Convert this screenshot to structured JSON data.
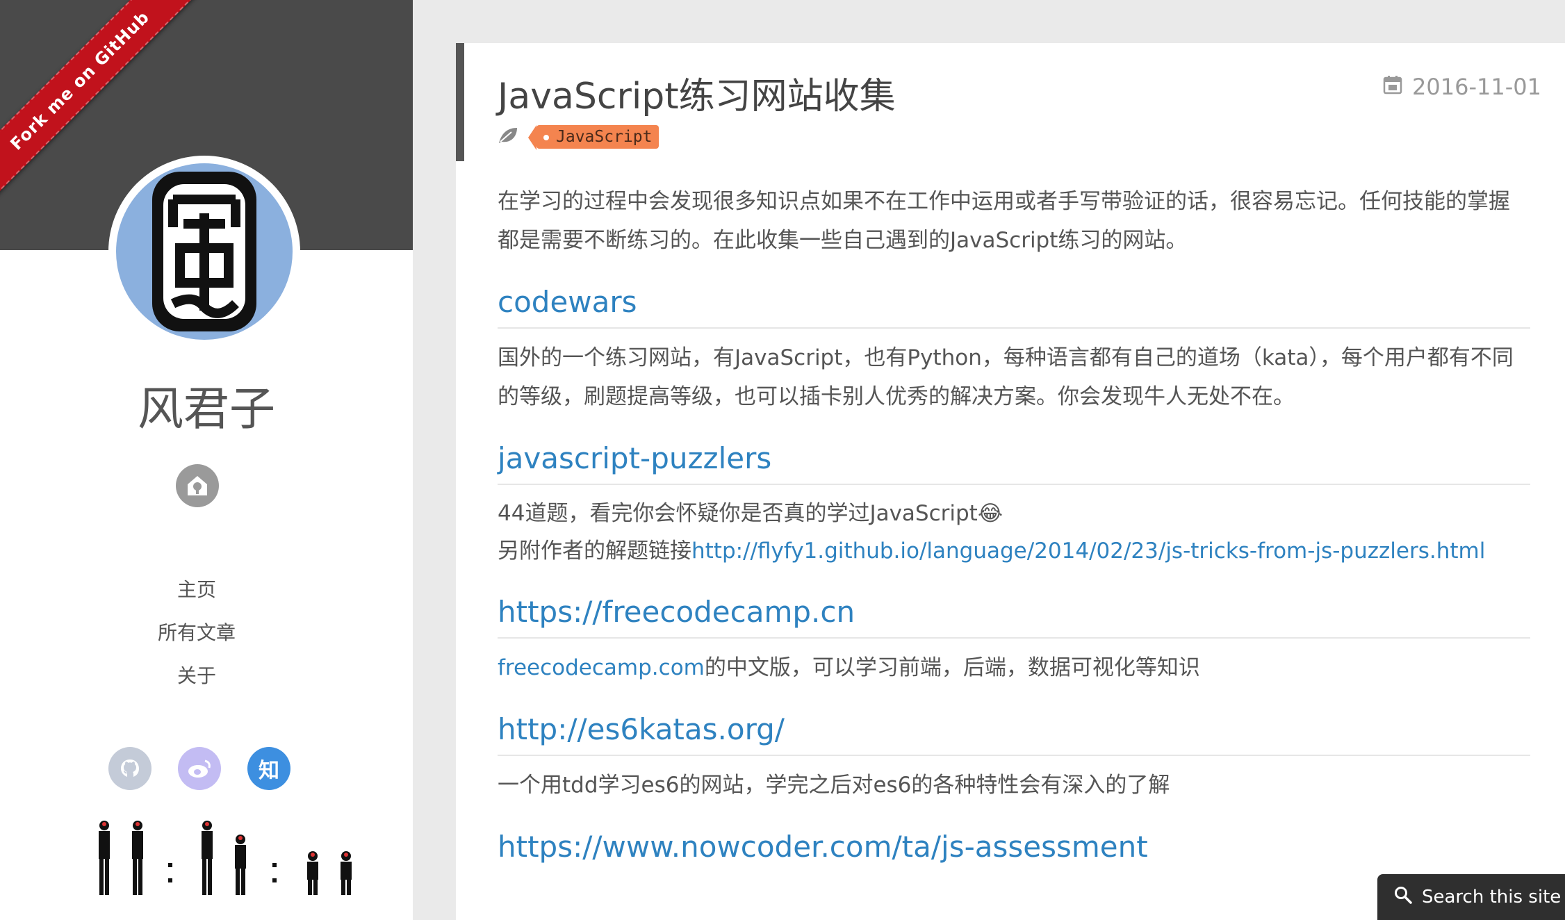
{
  "sidebar": {
    "ribbon": "Fork me on GitHub",
    "author_name": "风君子",
    "nav": [
      {
        "label": "主页"
      },
      {
        "label": "所有文章"
      },
      {
        "label": "关于"
      }
    ],
    "social": {
      "zhihu": "知"
    }
  },
  "post": {
    "title": "JavaScript练习网站收集",
    "date": "2016-11-01",
    "tags": [
      "JavaScript"
    ],
    "intro": "在学习的过程中会发现很多知识点如果不在工作中运用或者手写带验证的话，很容易忘记。任何技能的掌握都是需要不断练习的。在此收集一些自己遇到的JavaScript练习的网站。",
    "sections": [
      {
        "heading": "codewars",
        "text": "国外的一个练习网站，有JavaScript，也有Python，每种语言都有自己的道场（kata），每个用户都有不同的等级，刷题提高等级，也可以插卡别人优秀的解决方案。你会发现牛人无处不在。"
      },
      {
        "heading": "javascript-puzzlers",
        "text": "44道题，看完你会怀疑你是否真的学过JavaScript😂",
        "text2": "另附作者的解题链接",
        "link": "http://flyfy1.github.io/language/2014/02/23/js-tricks-from-js-puzzlers.html"
      },
      {
        "heading": "https://freecodecamp.cn",
        "link": "freecodecamp.com",
        "text": "的中文版，可以学习前端，后端，数据可视化等知识"
      },
      {
        "heading": "http://es6katas.org/",
        "text": "一个用tdd学习es6的网站，学完之后对es6的各种特性会有深入的了解"
      },
      {
        "heading": "https://www.nowcoder.com/ta/js-assessment"
      }
    ]
  },
  "search": {
    "label": "Search this site"
  },
  "colors": {
    "link": "#2e82c0",
    "tag": "#f4844f",
    "ribbon": "#c1121c",
    "sidebar_dark": "#4a4a4a"
  }
}
